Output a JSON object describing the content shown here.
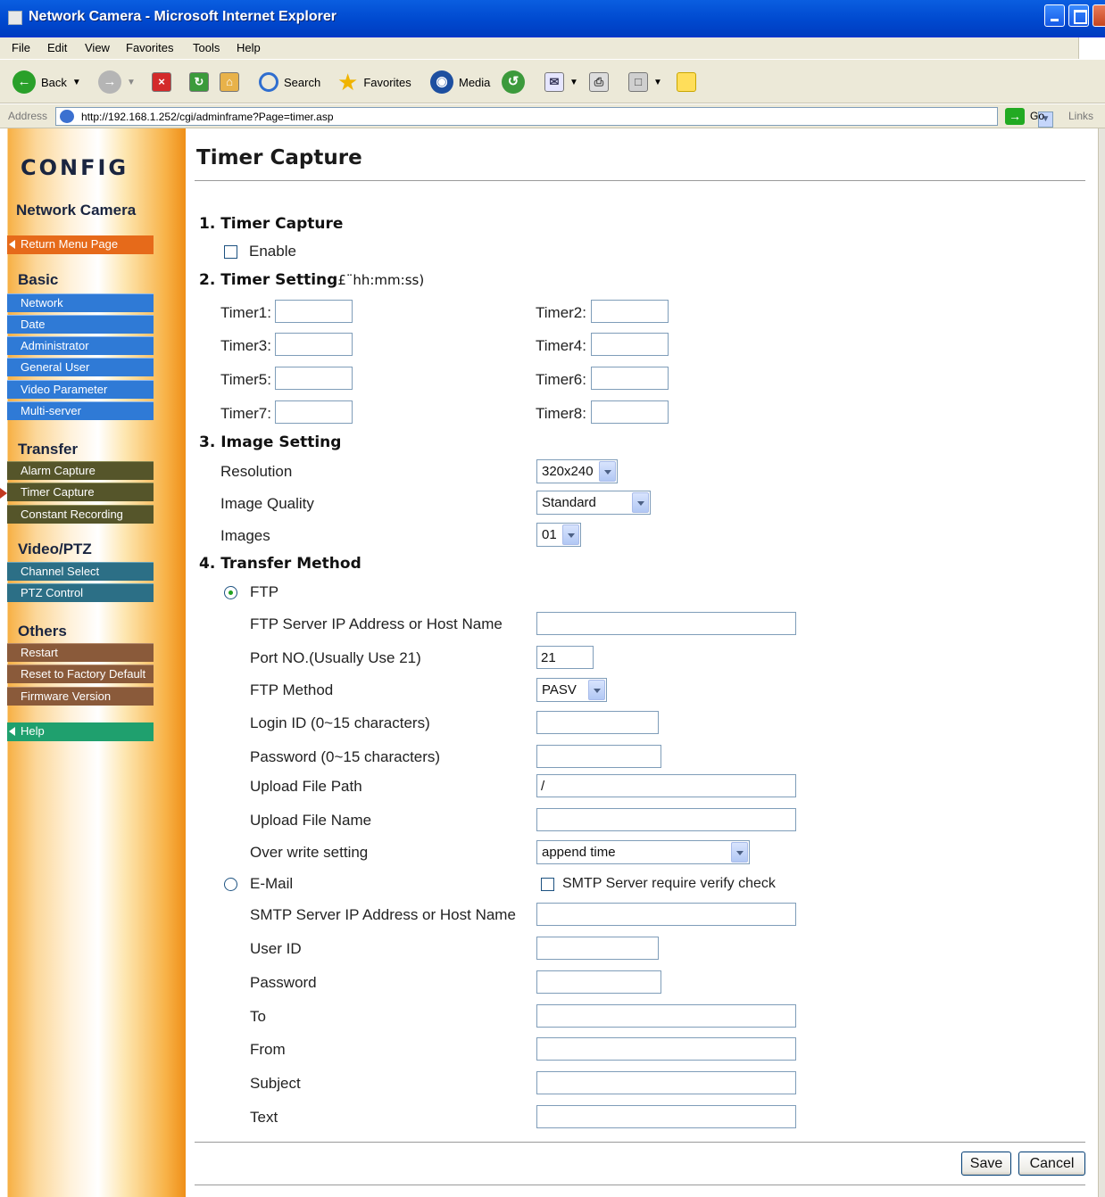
{
  "window": {
    "title": "Network Camera - Microsoft Internet Explorer"
  },
  "menu": [
    "File",
    "Edit",
    "View",
    "Favorites",
    "Tools",
    "Help"
  ],
  "toolbar": {
    "back": "Back",
    "search": "Search",
    "favorites": "Favorites",
    "media": "Media"
  },
  "address": {
    "label": "Address",
    "url": "http://192.168.1.252/cgi/adminframe?Page=timer.asp",
    "go": "Go",
    "links": "Links"
  },
  "sidebar": {
    "logo": "CONFIG",
    "product": "Network Camera",
    "return_label": "Return Menu Page",
    "basic": {
      "title": "Basic",
      "items": [
        "Network",
        "Date",
        "Administrator",
        "General User",
        "Video Parameter",
        "Multi-server"
      ]
    },
    "transfer": {
      "title": "Transfer",
      "items": [
        "Alarm Capture",
        "Timer Capture",
        "Constant Recording"
      ]
    },
    "video": {
      "title": "Video/PTZ",
      "items": [
        "Channel Select",
        "PTZ Control"
      ]
    },
    "others": {
      "title": "Others",
      "items": [
        "Restart",
        "Reset to Factory Default",
        "Firmware Version"
      ]
    },
    "help": "Help"
  },
  "page": {
    "title": "Timer Capture",
    "s1": {
      "title": "1. Timer Capture",
      "enable": "Enable",
      "enable_checked": false
    },
    "s2": {
      "title": "2. Timer Setting",
      "unit": "£¨hh:mm:ss)",
      "timers": [
        {
          "label": "Timer1:",
          "value": ""
        },
        {
          "label": "Timer2:",
          "value": ""
        },
        {
          "label": "Timer3:",
          "value": ""
        },
        {
          "label": "Timer4:",
          "value": ""
        },
        {
          "label": "Timer5:",
          "value": ""
        },
        {
          "label": "Timer6:",
          "value": ""
        },
        {
          "label": "Timer7:",
          "value": ""
        },
        {
          "label": "Timer8:",
          "value": ""
        }
      ]
    },
    "s3": {
      "title": "3. Image Setting",
      "resolution_label": "Resolution",
      "resolution_value": "320x240",
      "quality_label": "Image Quality",
      "quality_value": "Standard",
      "images_label": "Images",
      "images_value": "01"
    },
    "s4": {
      "title": "4. Transfer Method",
      "ftp": "FTP",
      "ftp_selected": true,
      "ftp_server_label": "FTP Server IP Address or Host Name",
      "ftp_server_value": "",
      "port_label": "Port NO.(Usually Use 21)",
      "port_value": "21",
      "method_label": "FTP Method",
      "method_value": "PASV",
      "login_label": "Login ID (0~15 characters)",
      "login_value": "",
      "pwd_label": "Password (0~15 characters)",
      "pwd_value": "",
      "path_label": "Upload File Path",
      "path_value": "/",
      "fname_label": "Upload File Name",
      "fname_value": "",
      "overwrite_label": "Over write setting",
      "overwrite_value": "append time",
      "email": "E-Mail",
      "email_selected": false,
      "smtp_verify": "SMTP Server require verify check",
      "smtp_verify_checked": false,
      "smtp_label": "SMTP Server IP Address or Host Name",
      "smtp_value": "",
      "userid_label": "User ID",
      "userid_value": "",
      "epwd_label": "Password",
      "epwd_value": "",
      "to_label": "To",
      "to_value": "",
      "from_label": "From",
      "from_value": "",
      "subject_label": "Subject",
      "subject_value": "",
      "text_label": "Text",
      "text_value": ""
    },
    "save": "Save",
    "cancel": "Cancel"
  }
}
